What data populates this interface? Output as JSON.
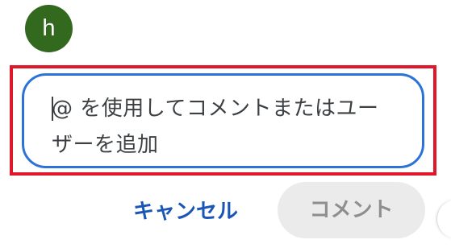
{
  "avatar": {
    "letter": "h"
  },
  "comment_input": {
    "placeholder": "@ を使用してコメントまたはユーザーを追加"
  },
  "actions": {
    "cancel_label": "キャンセル",
    "submit_label": "コメント"
  },
  "colors": {
    "avatar_bg": "#33691e",
    "highlight": "#e0162b",
    "input_border": "#2b73d8",
    "cancel_text": "#1a55b8",
    "submit_bg": "#ebebeb",
    "submit_text": "#8e8e8e"
  }
}
